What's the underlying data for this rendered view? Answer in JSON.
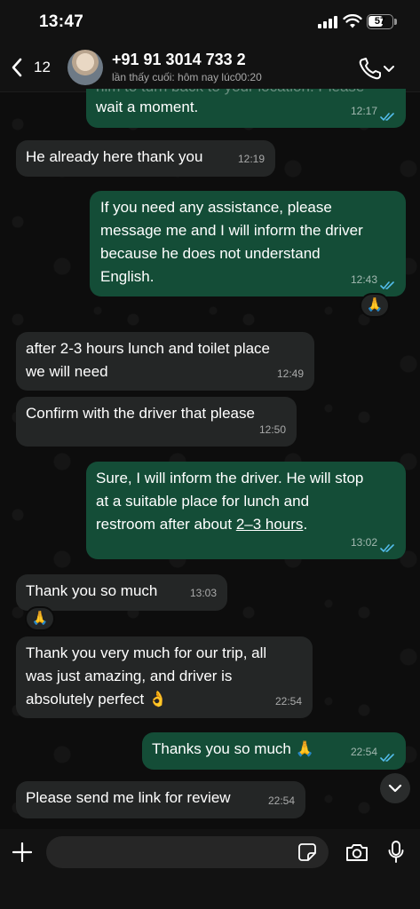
{
  "status": {
    "time": "13:47",
    "battery": "57"
  },
  "header": {
    "back_count": "12",
    "contact_name": "+91 91 3014 733 2",
    "last_seen": "lần thấy cuối: hôm nay lúc00:20"
  },
  "messages": [
    {
      "dir": "out",
      "text_partial": "him to turn back to your location. Please",
      "text": "wait a moment.",
      "time": "12:17"
    },
    {
      "dir": "in",
      "text": "He already here thank you",
      "time": "12:19"
    },
    {
      "dir": "out",
      "text": "If you need any assistance, please message me and I will inform the driver because he does not understand English.",
      "lines": [
        "If you need any assistance, please",
        "message me and I will inform the driver",
        "because he does not understand",
        "English."
      ],
      "time": "12:43",
      "reaction": "🙏"
    },
    {
      "dir": "in",
      "lines": [
        "after 2-3 hours lunch and toilet place",
        "we will need"
      ],
      "time": "12:49"
    },
    {
      "dir": "in",
      "text": "Confirm with the driver that  please",
      "time": "12:50"
    },
    {
      "dir": "out",
      "lines": [
        "Sure, I will inform the driver. He will stop",
        "at a suitable place for lunch and",
        "restroom after about "
      ],
      "link": "2–3 hours",
      "tail": ".",
      "time": "13:02"
    },
    {
      "dir": "in",
      "text": "Thank you so much",
      "time": "13:03",
      "reaction": "🙏"
    },
    {
      "dir": "in",
      "lines": [
        "Thank  you very much for our trip, all",
        "was just amazing,  and driver is",
        "absolutely perfect 👌"
      ],
      "time": "22:54"
    },
    {
      "dir": "out",
      "text": "Thanks you so much 🙏",
      "time": "22:54"
    },
    {
      "dir": "in",
      "text": "Please send me link for review",
      "time": "22:54"
    }
  ],
  "input": {
    "placeholder": ""
  },
  "icons": {
    "back": "chevron-left-icon",
    "call": "phone-icon",
    "scroll": "chevron-down-icon",
    "attach": "plus-icon",
    "sticker": "sticker-icon",
    "camera": "camera-icon",
    "mic": "microphone-icon"
  },
  "colors": {
    "incoming": "#242626",
    "outgoing": "#144d37",
    "ticks": "#53bdeb",
    "background": "#0b0b0b"
  }
}
